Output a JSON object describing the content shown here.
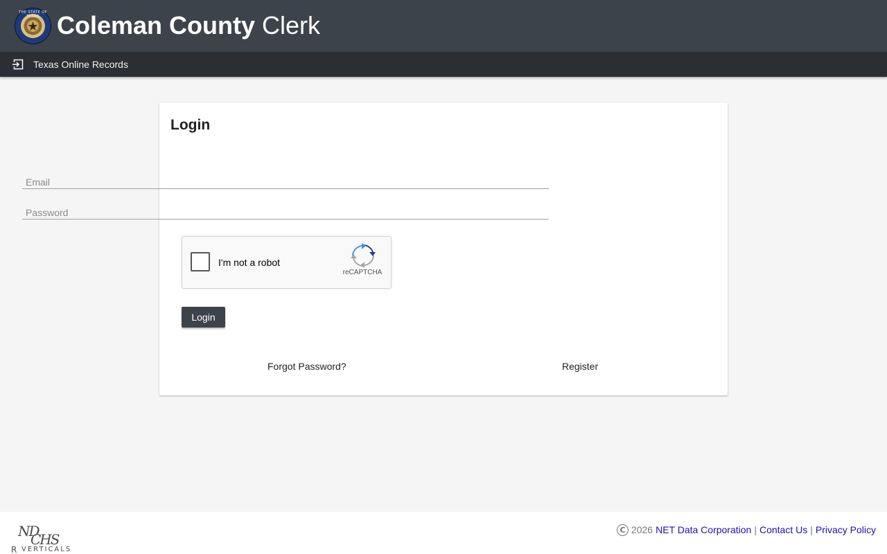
{
  "header": {
    "title_bold": "Coleman County",
    "title_light": "Clerk",
    "seal_text": "THE STATE OF TEXAS"
  },
  "subbar": {
    "label": "Texas Online Records",
    "icon": "login-icon"
  },
  "login": {
    "title": "Login",
    "email_placeholder": "Email",
    "email_value": "",
    "password_placeholder": "Password",
    "password_value": "",
    "captcha_label": "I'm not a robot",
    "captcha_brand": "reCAPTCHA",
    "button_label": "Login",
    "forgot_label": "Forgot Password?",
    "register_label": "Register"
  },
  "footer": {
    "logo_nd": "ND",
    "logo_chs": "CHS",
    "logo_verticals": "VERTICALS",
    "logo_mark": "R",
    "copyright_symbol": "C",
    "year": "2026",
    "company": "NET Data Corporation",
    "contact": "Contact Us",
    "privacy": "Privacy Policy",
    "separator": "|"
  },
  "colors": {
    "header_bg": "#3d434b",
    "subbar_bg": "#2b2f34",
    "page_bg": "#f5f5f5",
    "button_bg": "#3d434b",
    "footer_link": "#1a10b8"
  }
}
